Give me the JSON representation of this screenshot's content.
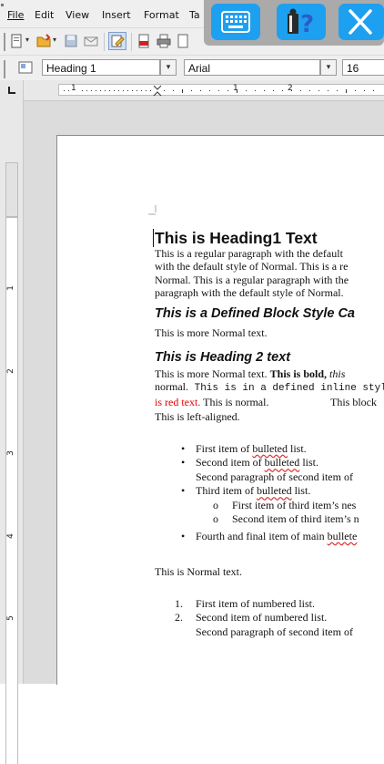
{
  "menubar": {
    "items": [
      {
        "label": "File"
      },
      {
        "label": "Edit"
      },
      {
        "label": "View"
      },
      {
        "label": "Insert"
      },
      {
        "label": "Format"
      },
      {
        "label": "Ta"
      }
    ]
  },
  "formatting": {
    "style": "Heading 1",
    "font": "Arial",
    "size": "16"
  },
  "ruler": {
    "h_labels": [
      "1",
      "1",
      "2"
    ],
    "v_labels": [
      "1",
      "2",
      "3",
      "4",
      "5"
    ]
  },
  "document": {
    "heading1": "This is Heading1 Text",
    "para1": [
      "This is a regular paragraph with the default",
      "with the default style of Normal. This is a re",
      "Normal. This is a regular paragraph with the",
      "paragraph with the default style of Normal."
    ],
    "heading_defined": "This is a Defined Block Style Ca",
    "more_normal_1": "This is more Normal text.",
    "heading2": "This is Heading 2 text",
    "mixed": {
      "line1_normal": "This is more Normal text. ",
      "line1_bold": "This is bold,",
      "line1_italic": " this",
      "line2_normal": "normal.",
      "line2_mono": " This is in a defined inline styl",
      "line3_red": "is red text.",
      "line3_normal": " This is normal.",
      "line3_block": "This block"
    },
    "left_aligned": "This is left-aligned.",
    "bullets": [
      {
        "pre": "First item of ",
        "squig": "bulleted",
        "post": " list."
      },
      {
        "pre": "Second item of ",
        "squig": "bulleted",
        "post": " list."
      },
      {
        "pre": "Second paragraph of second item of",
        "squig": "",
        "post": ""
      },
      {
        "pre": "Third item of ",
        "squig": "bulleted",
        "post": " list."
      },
      {
        "pre": "Fourth and final item of main ",
        "squig": "bullete",
        "post": ""
      }
    ],
    "sub_bullets": [
      "First item of third item’s nes",
      "Second item of third item’s n"
    ],
    "bullet_mark": "•",
    "sub_bullet_mark": "o",
    "normal_text": "This is Normal text.",
    "numbered": [
      {
        "n": "1.",
        "text": "First item of numbered list."
      },
      {
        "n": "2.",
        "text": "Second item of numbered list."
      },
      {
        "n": "",
        "text": "Second paragraph of second item of"
      }
    ]
  },
  "osk": {
    "buttons": [
      "keyboard-icon",
      "help-icon",
      "close-icon"
    ],
    "accent": "#1ea0f0"
  }
}
